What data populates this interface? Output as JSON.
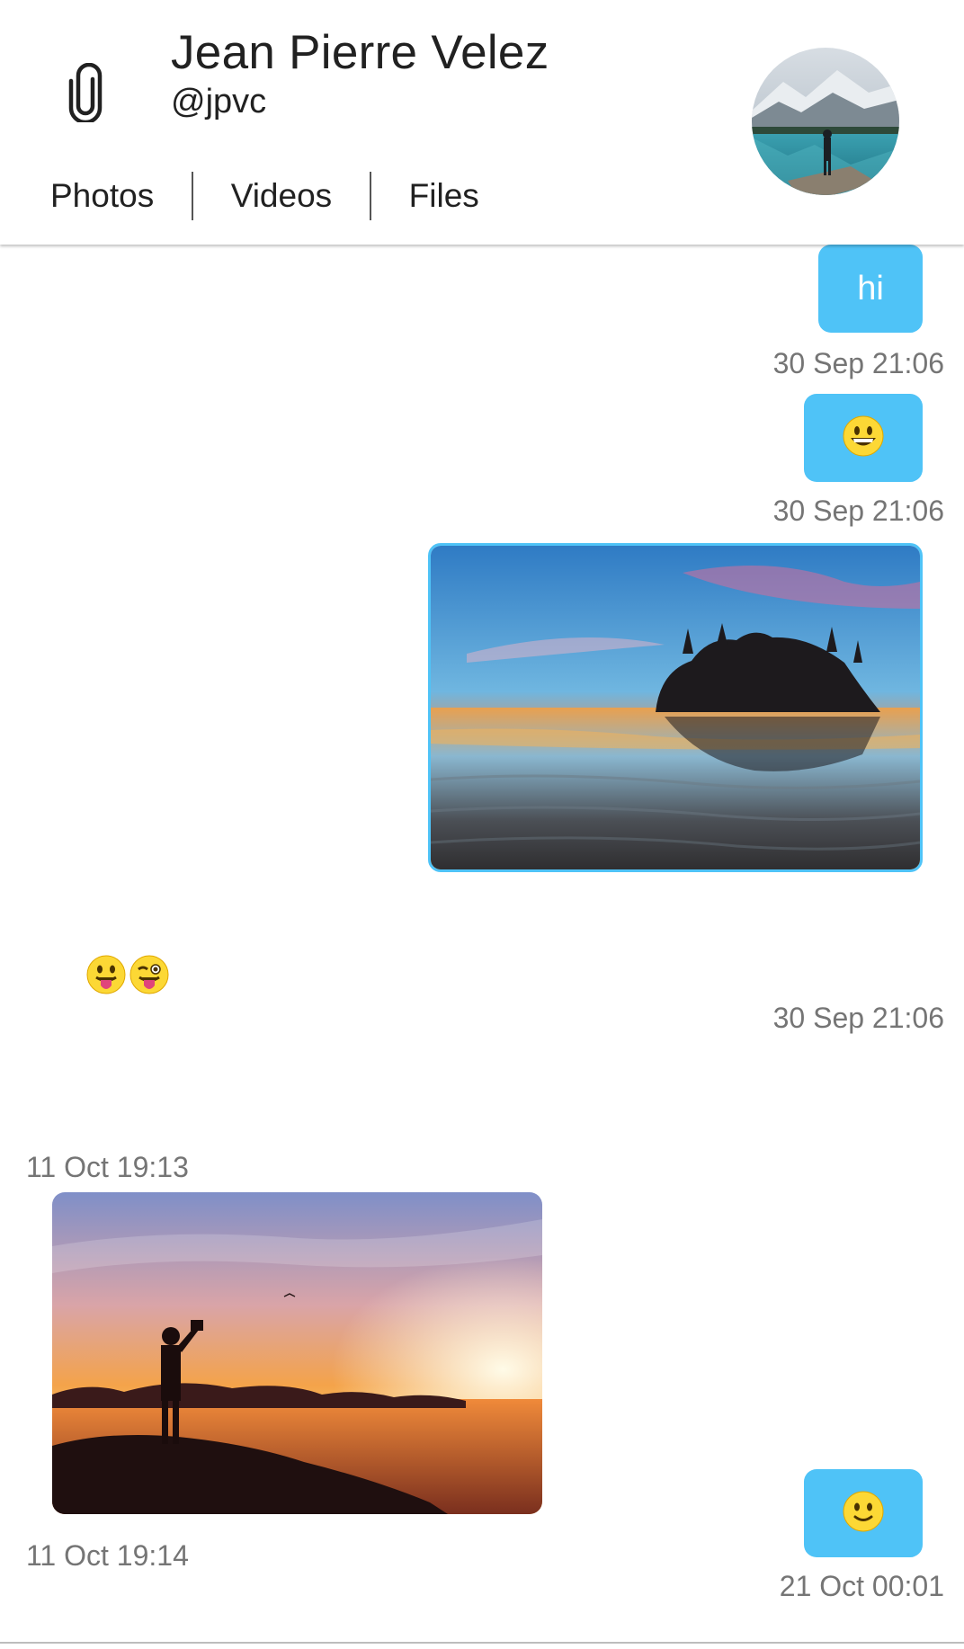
{
  "header": {
    "name": "Jean Pierre Velez",
    "handle": "@jpvc",
    "attach_icon": "paperclip-icon",
    "avatar": "profile-photo-mountain-lake",
    "tabs": [
      {
        "label": "Photos"
      },
      {
        "label": "Videos"
      },
      {
        "label": "Files"
      }
    ]
  },
  "messages": [
    {
      "direction": "sent",
      "type": "text",
      "text": "hi",
      "time": "30 Sep 21:06"
    },
    {
      "direction": "sent",
      "type": "emoji",
      "emoji": "grinning-face",
      "time": "30 Sep 21:06"
    },
    {
      "direction": "sent",
      "type": "image",
      "image": "beach-sunset-sea-stack",
      "time": "30 Sep 21:06"
    },
    {
      "direction": "received",
      "type": "emoji",
      "emoji": [
        "face-with-tongue",
        "winking-face-with-tongue"
      ],
      "time": "11 Oct 19:13"
    },
    {
      "direction": "received",
      "type": "image",
      "image": "sunset-silhouette-photographer",
      "time": "11 Oct 19:14"
    },
    {
      "direction": "sent",
      "type": "emoji",
      "emoji": "slightly-smiling-face",
      "time": "21 Oct 00:01"
    }
  ],
  "colors": {
    "sent_bubble": "#4fc3f7",
    "timestamp": "#757575",
    "text": "#212121"
  }
}
